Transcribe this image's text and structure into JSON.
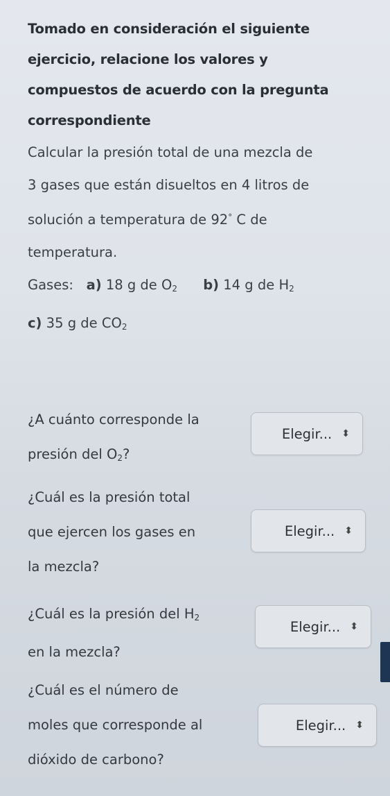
{
  "intro": {
    "line1": "Tomado en consideración el siguiente",
    "line2": "ejercicio, relacione los valores y",
    "line3": "compuestos de acuerdo con la pregunta",
    "line4": "correspondiente"
  },
  "problem": {
    "line1": "Calcular la presión total de una mezcla de",
    "line2": "3 gases que están disueltos en 4 litros de",
    "line3_pre": "solución a temperatura de 92",
    "line3_deg": "°",
    "line3_post": " C de",
    "line4": "temperatura."
  },
  "gases": {
    "label": "Gases:",
    "a_letter": "a)",
    "a_text": " 18 g de O",
    "a_sub": "2",
    "b_letter": "b)",
    "b_text": " 14 g de H",
    "b_sub": "2",
    "c_letter": "c)",
    "c_text": " 35 g de CO",
    "c_sub": "2"
  },
  "questions": [
    {
      "line1": "¿A cuánto corresponde la",
      "line2_pre": "presión del O",
      "line2_sub": "2",
      "line2_post": "?",
      "select": "Elegir..."
    },
    {
      "line1": "¿Cuál es la presión total",
      "line2": "que ejercen los gases en",
      "line3": "la mezcla?",
      "select": "Elegir..."
    },
    {
      "line1_pre": "¿Cuál es la presión del H",
      "line1_sub": "2",
      "line2": "en la mezcla?",
      "select": "Elegir..."
    },
    {
      "line1": "¿Cuál es el número de",
      "line2": "moles que corresponde al",
      "line3": "dióxido de carbono?",
      "select": "Elegir..."
    }
  ],
  "icons": {
    "select_arrow": "updown-chevron-icon"
  }
}
